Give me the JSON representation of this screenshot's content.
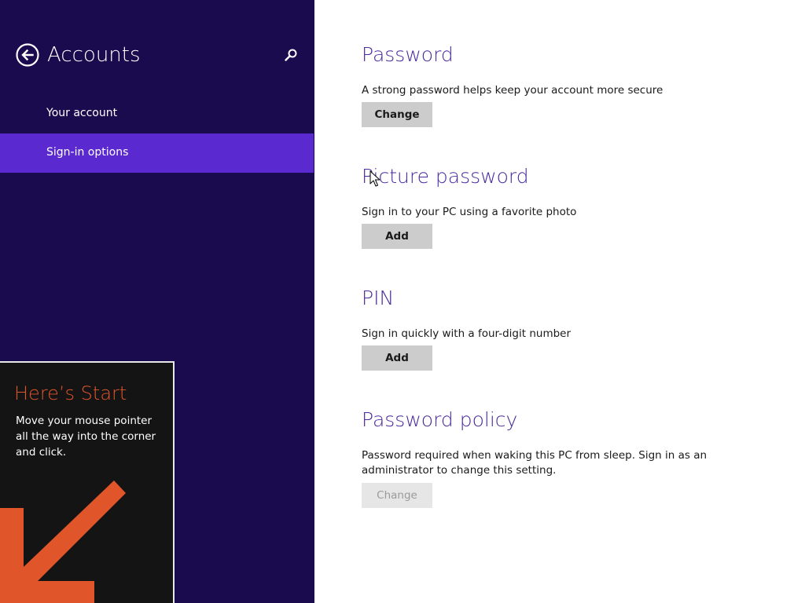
{
  "sidebar": {
    "title": "Accounts",
    "back_icon": "back-arrow-circle-icon",
    "search_icon": "search-icon",
    "items": [
      {
        "label": "Your account",
        "selected": false
      },
      {
        "label": "Sign-in options",
        "selected": true
      }
    ],
    "background_color": "#1a0a4e",
    "selected_color": "#5a2ad0"
  },
  "tip": {
    "title": "Here’s Start",
    "body": "Move your mouse pointer all the way into the corner and click.",
    "arrow_icon": "down-left-arrow-icon",
    "accent_color": "#e0562a"
  },
  "main": {
    "accent_color": "#4a2a9c",
    "sections": [
      {
        "title": "Password",
        "description": "A strong password helps keep your account more secure",
        "button_label": "Change",
        "button_enabled": true
      },
      {
        "title": "Picture password",
        "description": "Sign in to your PC using a favorite photo",
        "button_label": "Add",
        "button_enabled": true
      },
      {
        "title": "PIN",
        "description": "Sign in quickly with a four-digit number",
        "button_label": "Add",
        "button_enabled": true
      },
      {
        "title": "Password policy",
        "description": "Password required when waking this PC from sleep. Sign in as an administrator to change this setting.",
        "button_label": "Change",
        "button_enabled": false
      }
    ]
  }
}
